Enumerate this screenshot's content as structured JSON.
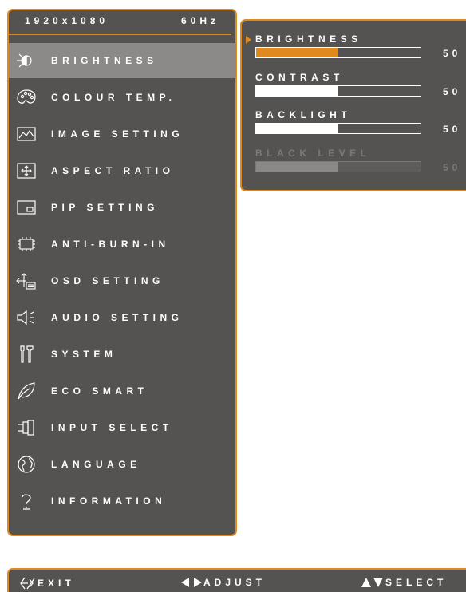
{
  "header": {
    "resolution": "1920x1080",
    "refresh": "60Hz"
  },
  "menu": {
    "items": [
      {
        "label": "BRIGHTNESS",
        "icon": "brightness-icon",
        "active": true
      },
      {
        "label": "COLOUR TEMP.",
        "icon": "palette-icon"
      },
      {
        "label": "IMAGE SETTING",
        "icon": "image-icon"
      },
      {
        "label": "ASPECT RATIO",
        "icon": "aspect-ratio-icon"
      },
      {
        "label": "PIP SETTING",
        "icon": "pip-icon"
      },
      {
        "label": "ANTI-BURN-IN",
        "icon": "chip-icon"
      },
      {
        "label": "OSD SETTING",
        "icon": "osd-icon"
      },
      {
        "label": "AUDIO SETTING",
        "icon": "speaker-icon"
      },
      {
        "label": "SYSTEM",
        "icon": "tools-icon"
      },
      {
        "label": "ECO SMART",
        "icon": "leaf-icon"
      },
      {
        "label": "INPUT SELECT",
        "icon": "plug-icon"
      },
      {
        "label": "LANGUAGE",
        "icon": "globe-icon"
      },
      {
        "label": "INFORMATION",
        "icon": "question-icon"
      }
    ]
  },
  "submenu": {
    "items": [
      {
        "label": "BRIGHTNESS",
        "value": "50",
        "level": 0.5,
        "selected": true
      },
      {
        "label": "CONTRAST",
        "value": "50",
        "level": 0.5
      },
      {
        "label": "BACKLIGHT",
        "value": "50",
        "level": 0.5
      },
      {
        "label": "BLACK LEVEL",
        "value": "50",
        "level": 0.5,
        "disabled": true
      }
    ]
  },
  "footer": {
    "exit": "EXIT",
    "adjust": "ADJUST",
    "select": "SELECT"
  },
  "colors": {
    "accent": "#e08a1e",
    "panel": "#545352",
    "highlight": "#8b8a89"
  }
}
